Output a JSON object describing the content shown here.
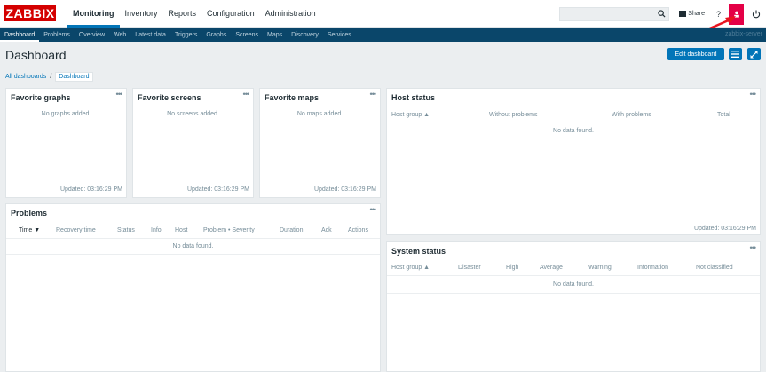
{
  "logo": "ZABBIX",
  "mainmenu": [
    "Monitoring",
    "Inventory",
    "Reports",
    "Configuration",
    "Administration"
  ],
  "topbar": {
    "share": "Share",
    "help": "?"
  },
  "submenu": [
    "Dashboard",
    "Problems",
    "Overview",
    "Web",
    "Latest data",
    "Triggers",
    "Graphs",
    "Screens",
    "Maps",
    "Discovery",
    "Services"
  ],
  "server_name": "zabbix-server",
  "page": {
    "title": "Dashboard",
    "edit_button": "Edit dashboard"
  },
  "breadcrumb": {
    "parent": "All dashboards",
    "separator": "/",
    "current": "Dashboard"
  },
  "widgets": {
    "dots": "•••",
    "fav_graphs": {
      "title": "Favorite graphs",
      "empty": "No graphs added.",
      "updated": "Updated: 03:16:29 PM"
    },
    "fav_screens": {
      "title": "Favorite screens",
      "empty": "No screens added.",
      "updated": "Updated: 03:16:29 PM"
    },
    "fav_maps": {
      "title": "Favorite maps",
      "empty": "No maps added.",
      "updated": "Updated: 03:16:29 PM"
    },
    "problems": {
      "title": "Problems",
      "columns": [
        "Time ▼",
        "Recovery time",
        "Status",
        "Info",
        "Host",
        "Problem • Severity",
        "Duration",
        "Ack",
        "Actions"
      ],
      "empty": "No data found."
    },
    "host_status": {
      "title": "Host status",
      "columns": [
        "Host group ▲",
        "Without problems",
        "With problems",
        "Total"
      ],
      "empty": "No data found.",
      "updated": "Updated: 03:16:29 PM"
    },
    "system_status": {
      "title": "System status",
      "columns": [
        "Host group ▲",
        "Disaster",
        "High",
        "Average",
        "Warning",
        "Information",
        "Not classified"
      ],
      "empty": "No data found."
    }
  }
}
